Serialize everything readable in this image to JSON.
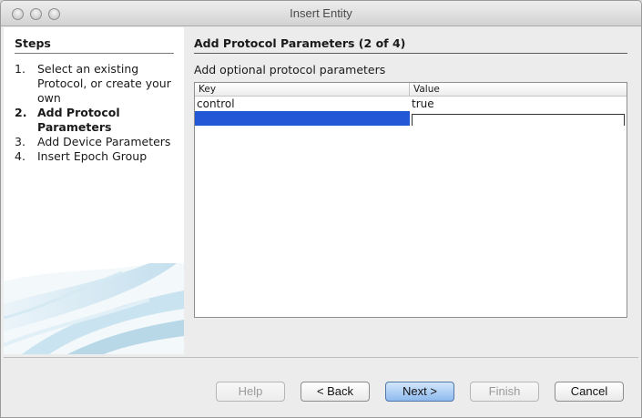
{
  "window": {
    "title": "Insert Entity"
  },
  "steps": {
    "heading": "Steps",
    "items": [
      {
        "num": "1.",
        "label": "Select an existing Protocol, or create your own"
      },
      {
        "num": "2.",
        "label": "Add Protocol Parameters"
      },
      {
        "num": "3.",
        "label": "Add Device Parameters"
      },
      {
        "num": "4.",
        "label": "Insert Epoch Group"
      }
    ]
  },
  "page": {
    "heading": "Add Protocol Parameters (2 of 4)",
    "subtitle": "Add optional protocol parameters"
  },
  "table": {
    "columns": [
      "Key",
      "Value"
    ],
    "rows": [
      {
        "key": "control",
        "value": "true"
      },
      {
        "key": "",
        "value": ""
      }
    ]
  },
  "buttons": {
    "help": "Help",
    "back": "< Back",
    "next": "Next >",
    "finish": "Finish",
    "cancel": "Cancel"
  }
}
